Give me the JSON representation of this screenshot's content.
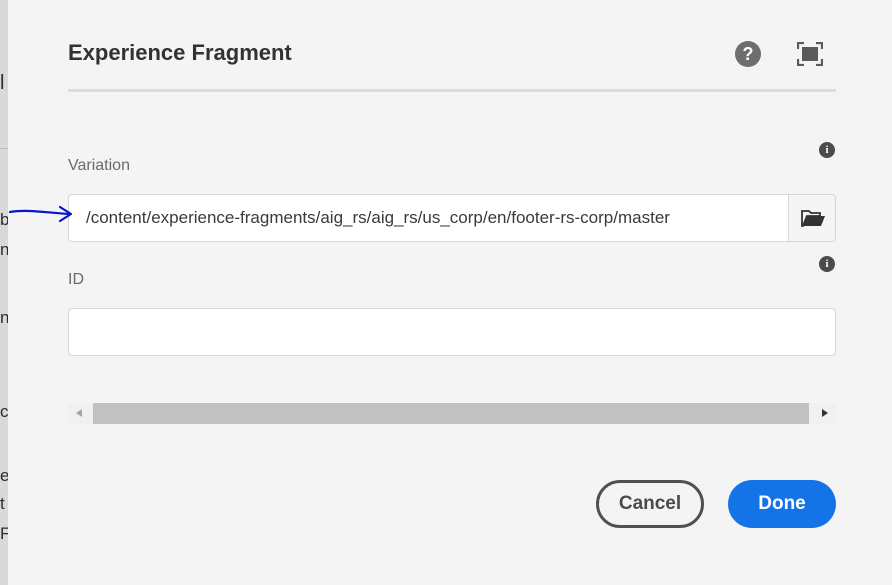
{
  "background": {
    "letters": [
      "l",
      "b",
      "n",
      "n",
      "c",
      "e",
      "t",
      "F"
    ]
  },
  "dialog": {
    "title": "Experience Fragment",
    "help_icon": "help-circle-icon",
    "help_glyph": "?",
    "fullscreen_icon": "fullscreen-icon",
    "variation": {
      "label": "Variation",
      "value": "/content/experience-fragments/aig_rs/aig_rs/us_corp/en/footer-rs-corp/master",
      "info_glyph": "i",
      "browse_icon": "folder-open-icon"
    },
    "id_field": {
      "label": "ID",
      "value": "",
      "info_glyph": "i"
    },
    "cancel_label": "Cancel",
    "done_label": "Done"
  },
  "colors": {
    "accent": "#1473e6",
    "annotation": "#0a16c8"
  }
}
